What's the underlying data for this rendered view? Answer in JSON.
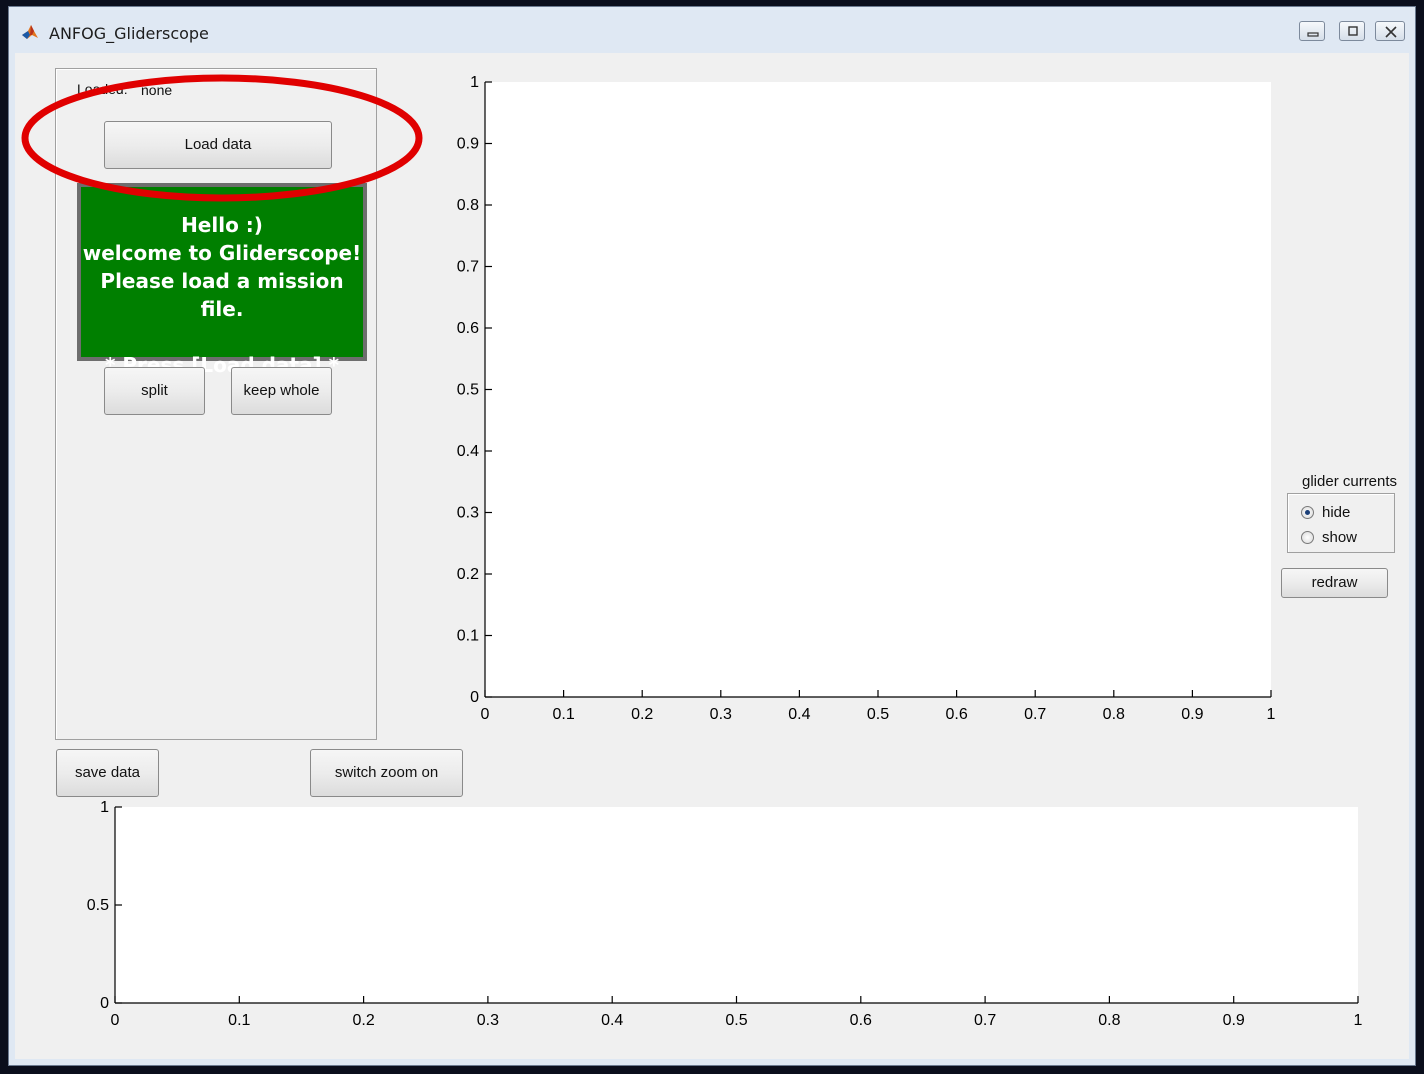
{
  "window": {
    "title": "ANFOG_Gliderscope",
    "controls": {
      "minimize_icon": "minimize-icon",
      "restore_icon": "restore-icon",
      "close_icon": "close-icon"
    }
  },
  "left_panel": {
    "loaded_label": "Loaded:",
    "loaded_value": "none",
    "load_button": "Load data",
    "message_lines": [
      "Hello :)",
      "welcome to Gliderscope!",
      "Please load a mission file.",
      "",
      "* Press [Load data] *"
    ],
    "split_button": "split",
    "keep_whole_button": "keep whole"
  },
  "bottom_controls": {
    "save_button": "save data",
    "zoom_button": "switch zoom on"
  },
  "glider_currents": {
    "title": "glider currents",
    "options": [
      {
        "label": "hide",
        "selected": true
      },
      {
        "label": "show",
        "selected": false
      }
    ],
    "redraw_button": "redraw"
  },
  "colors": {
    "message_bg": "#007f00",
    "annotation": "#e00000"
  },
  "chart_data": [
    {
      "type": "line",
      "series": [],
      "xlim": [
        0,
        1
      ],
      "ylim": [
        0,
        1
      ],
      "xticks": [
        "0",
        "0.1",
        "0.2",
        "0.3",
        "0.4",
        "0.5",
        "0.6",
        "0.7",
        "0.8",
        "0.9",
        "1"
      ],
      "yticks": [
        "0",
        "0.1",
        "0.2",
        "0.3",
        "0.4",
        "0.5",
        "0.6",
        "0.7",
        "0.8",
        "0.9",
        "1"
      ],
      "grid": false
    },
    {
      "type": "line",
      "series": [],
      "xlim": [
        0,
        1
      ],
      "ylim": [
        0,
        1
      ],
      "xticks": [
        "0",
        "0.1",
        "0.2",
        "0.3",
        "0.4",
        "0.5",
        "0.6",
        "0.7",
        "0.8",
        "0.9",
        "1"
      ],
      "yticks": [
        "0",
        "0.5",
        "1"
      ],
      "grid": false
    }
  ]
}
